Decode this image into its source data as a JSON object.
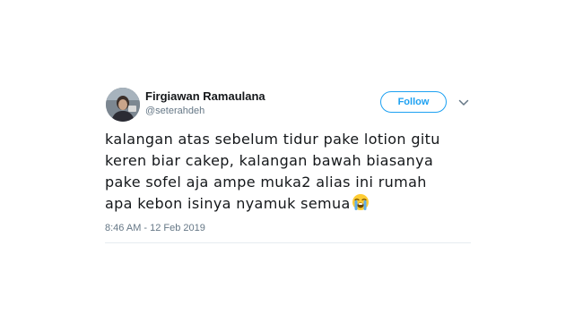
{
  "tweet": {
    "author_name": "Firgiawan Ramaulana",
    "author_handle": "@seterahdeh",
    "follow_label": "Follow",
    "text_lines": [
      "kalangan atas sebelum tidur pake lotion gitu",
      "keren biar cakep, kalangan bawah biasanya",
      "pake sofel aja ampe muka2 alias ini rumah",
      "apa kebon isinya nyamuk semua"
    ],
    "emoji": "loudly-crying-face-emoji",
    "timestamp": "8:46 AM - 12 Feb 2019"
  },
  "icons": {
    "caret": "chevron-down-icon",
    "avatar": "avatar-photo"
  },
  "colors": {
    "accent": "#1da1f2",
    "text": "#14171a",
    "secondary_text": "#657786",
    "divider": "#e6ecf0"
  }
}
